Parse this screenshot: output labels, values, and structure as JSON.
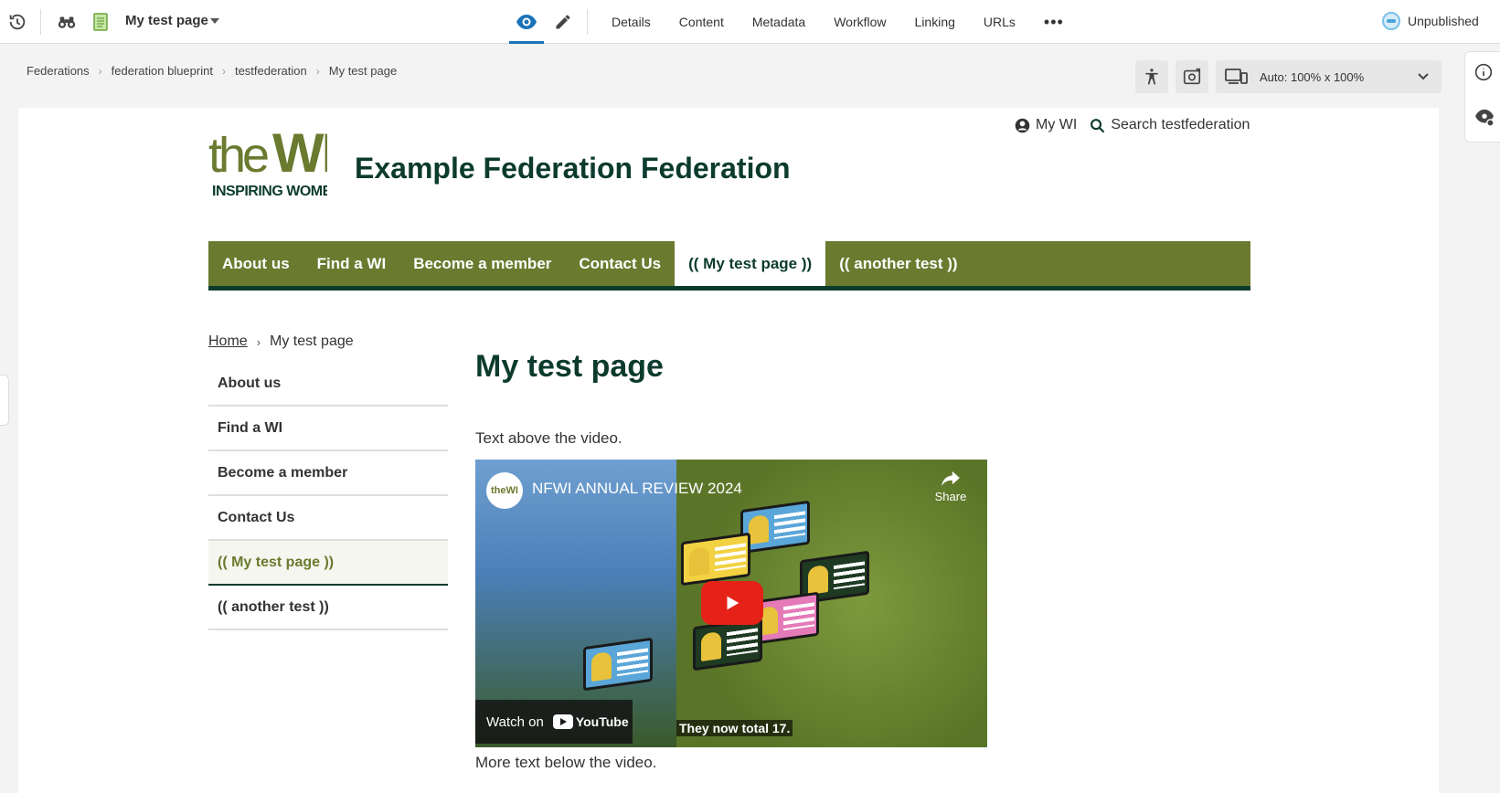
{
  "toolbar": {
    "page_name": "My test page",
    "tabs": [
      "Details",
      "Content",
      "Metadata",
      "Workflow",
      "Linking",
      "URLs"
    ],
    "more": "•••",
    "status": "Unpublished"
  },
  "editor_breadcrumb": [
    "Federations",
    "federation blueprint",
    "testfederation",
    "My test page"
  ],
  "zoom": {
    "label": "Auto: 100% x 100%"
  },
  "site": {
    "title": "Example Federation Federation",
    "logo_top": "theWI",
    "logo_bottom": "INSPIRING WOMEN",
    "util_my": "My WI",
    "util_search": "Search testfederation"
  },
  "main_nav": [
    "About us",
    "Find a WI",
    "Become a member",
    "Contact Us",
    "(( My test page ))",
    "(( another test ))"
  ],
  "page_breadcrumb": {
    "home": "Home",
    "current": "My test page"
  },
  "side_nav": [
    "About us",
    "Find a WI",
    "Become a member",
    "Contact Us",
    "(( My test page ))",
    "(( another test ))"
  ],
  "content": {
    "heading": "My test page",
    "text_above": "Text above the video.",
    "text_below": "More text below the video."
  },
  "video": {
    "title": "NFWI ANNUAL REVIEW 2024",
    "channel_logo": "theWI",
    "share": "Share",
    "watch_on": "Watch on",
    "brand": "YouTube",
    "caption": "They now total 17."
  },
  "colors": {
    "brand_green": "#6a7a2f",
    "dark_green": "#0c3b2e",
    "accent_blue": "#1a73b8"
  }
}
